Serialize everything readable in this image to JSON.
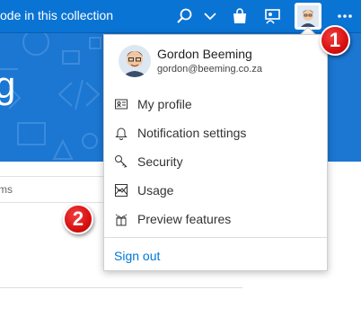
{
  "topbar": {
    "search_text": "ode in this collection",
    "icons": [
      "search-icon",
      "chevron-down-icon",
      "marketplace-bag-icon",
      "feedback-icon",
      "avatar",
      "more-icon"
    ]
  },
  "hero": {
    "title": "g"
  },
  "content": {
    "items_header": "ms"
  },
  "menu": {
    "user_name": "Gordon Beeming",
    "user_email": "gordon@beeming.co.za",
    "items": [
      {
        "label": "My profile",
        "icon": "profile-card-icon"
      },
      {
        "label": "Notification settings",
        "icon": "bell-icon"
      },
      {
        "label": "Security",
        "icon": "key-icon"
      },
      {
        "label": "Usage",
        "icon": "usage-chart-icon"
      },
      {
        "label": "Preview features",
        "icon": "preview-icon"
      }
    ],
    "sign_out": "Sign out"
  },
  "callouts": [
    "1",
    "2"
  ],
  "colors": {
    "topbar": "#0a74d4",
    "hero": "#1b77d2",
    "link": "#0078d7",
    "callout": "#d81010"
  }
}
